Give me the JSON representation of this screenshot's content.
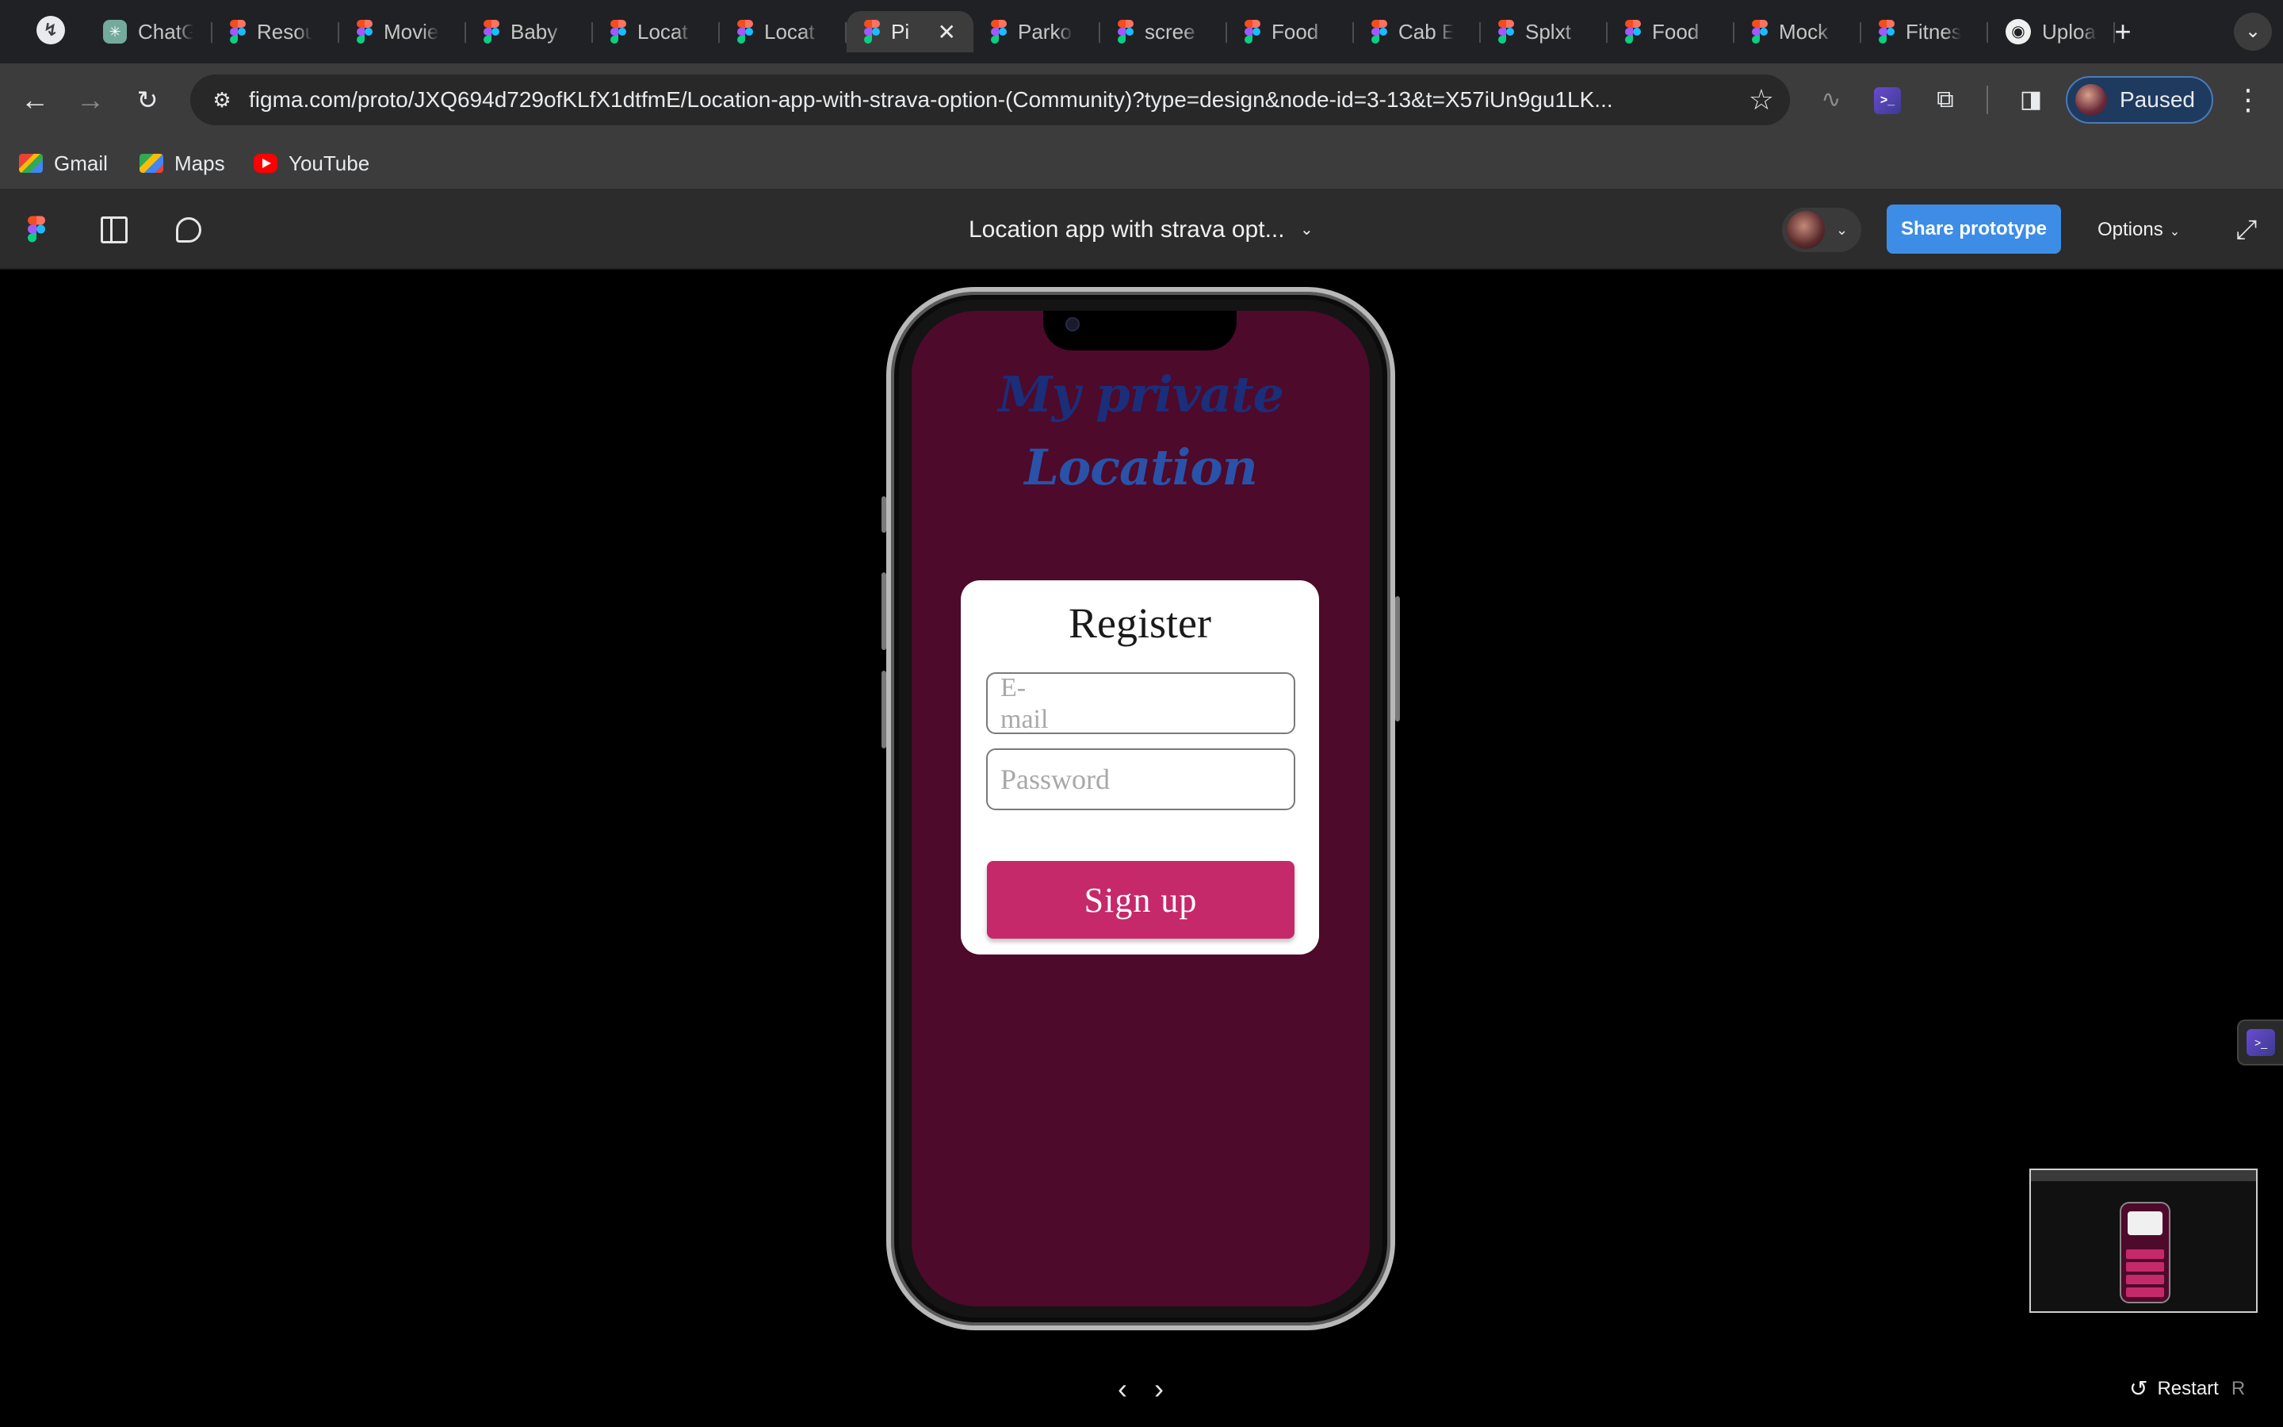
{
  "browser": {
    "tabs": [
      {
        "title": "ChatG",
        "icon": "chatgpt-icon"
      },
      {
        "title": "Resou",
        "icon": "figma-icon"
      },
      {
        "title": "Movie",
        "icon": "figma-icon"
      },
      {
        "title": "Baby",
        "icon": "figma-icon"
      },
      {
        "title": "Locat",
        "icon": "figma-icon"
      },
      {
        "title": "Locat",
        "icon": "figma-icon"
      },
      {
        "title": "Pi",
        "icon": "figma-icon",
        "active": true
      },
      {
        "title": "Parko",
        "icon": "figma-icon"
      },
      {
        "title": "scree",
        "icon": "figma-icon"
      },
      {
        "title": "Food",
        "icon": "figma-icon"
      },
      {
        "title": "Cab E",
        "icon": "figma-icon"
      },
      {
        "title": "Splxt",
        "icon": "figma-icon"
      },
      {
        "title": "Food",
        "icon": "figma-icon"
      },
      {
        "title": "Mock",
        "icon": "figma-icon"
      },
      {
        "title": "Fitnes",
        "icon": "figma-icon"
      },
      {
        "title": "Uploa",
        "icon": "github-icon"
      }
    ],
    "new_tab_label": "+",
    "url": "figma.com/proto/JXQ694d729ofKLfX1dtfmE/Location-app-with-strava-option-(Community)?type=design&node-id=3-13&t=X57iUn9gu1LK...",
    "profile_status": "Paused",
    "bookmarks": [
      {
        "label": "Gmail",
        "icon": "gmail-icon"
      },
      {
        "label": "Maps",
        "icon": "maps-icon"
      },
      {
        "label": "YouTube",
        "icon": "youtube-icon"
      }
    ]
  },
  "figma": {
    "file_title": "Location app with strava opt...",
    "share_label": "Share prototype",
    "options_label": "Options",
    "restart_label": "Restart",
    "restart_shortcut": "R"
  },
  "app": {
    "title_line1": "My private",
    "title_line2": "Location",
    "register_title": "Register",
    "email_placeholder": "E-mail",
    "password_placeholder": "Password",
    "signup_label": "Sign  up"
  },
  "colors": {
    "screen_bg": "#4d0a2b",
    "signup_button": "#c6296a",
    "share_button": "#3d8de6",
    "title_text": "#1b2e7a"
  }
}
